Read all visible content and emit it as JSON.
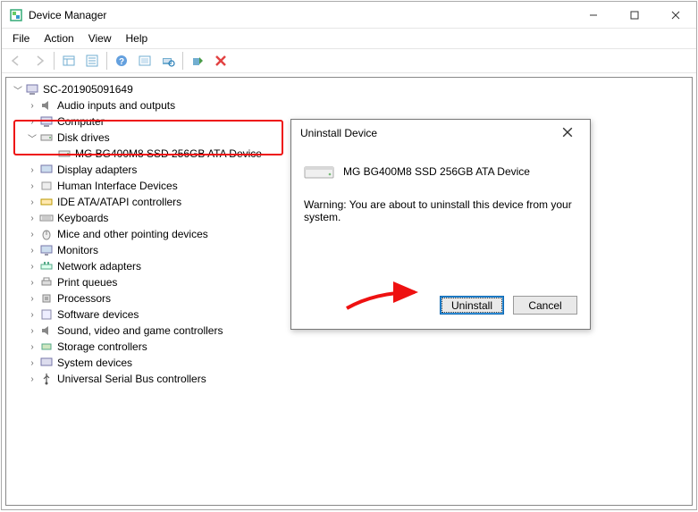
{
  "window": {
    "title": "Device Manager",
    "menus": {
      "file": "File",
      "action": "Action",
      "view": "View",
      "help": "Help"
    }
  },
  "tree": {
    "root": "SC-201905091649",
    "n_audio": "Audio inputs and outputs",
    "n_computer": "Computer",
    "n_disk": "Disk drives",
    "n_disk_dev": "MG  BG400M8  SSD 256GB ATA Device",
    "n_display": "Display adapters",
    "n_hid": "Human Interface Devices",
    "n_ide": "IDE ATA/ATAPI controllers",
    "n_kb": "Keyboards",
    "n_mice": "Mice and other pointing devices",
    "n_mon": "Monitors",
    "n_net": "Network adapters",
    "n_print": "Print queues",
    "n_proc": "Processors",
    "n_soft": "Software devices",
    "n_sound": "Sound, video and game controllers",
    "n_storage": "Storage controllers",
    "n_sys": "System devices",
    "n_usb": "Universal Serial Bus controllers"
  },
  "dialog": {
    "title": "Uninstall Device",
    "device": "MG  BG400M8  SSD 256GB ATA Device",
    "warning": "Warning: You are about to uninstall this device from your system.",
    "uninstall": "Uninstall",
    "cancel": "Cancel"
  }
}
